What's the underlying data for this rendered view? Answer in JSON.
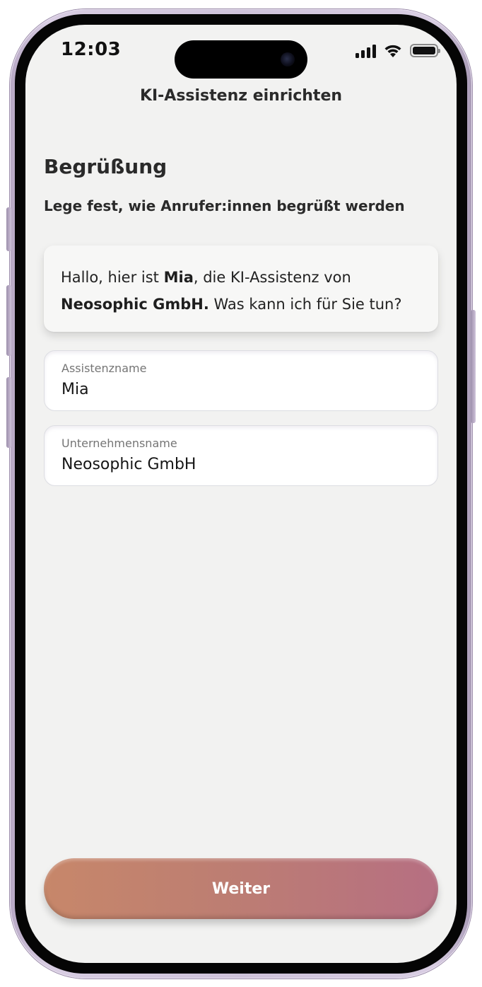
{
  "status_bar": {
    "time": "12:03",
    "signal_icon": "cellular-signal-icon",
    "wifi_icon": "wifi-icon",
    "battery_icon": "battery-icon",
    "battery_level": 1.0
  },
  "header": {
    "title": "KI-Assistenz einrichten"
  },
  "section": {
    "title": "Begrüßung",
    "subtitle": "Lege fest, wie Anrufer:innen begrüßt werden"
  },
  "greeting_preview": {
    "part1": "Hallo, hier ist ",
    "assistant_name": "Mia",
    "part2": ", die KI-Assistenz von ",
    "company_name": "Neosophic GmbH.",
    "part3": " Was kann ich für Sie tun?"
  },
  "fields": {
    "assistant_name": {
      "label": "Assistenzname",
      "value": "Mia"
    },
    "company_name": {
      "label": "Unternehmensname",
      "value": "Neosophic GmbH"
    }
  },
  "actions": {
    "continue_label": "Weiter"
  },
  "colors": {
    "screen_background": "#f2f2f1",
    "button_gradient_start": "#c7876a",
    "button_gradient_end": "#b66f82",
    "device_frame": "#cfc3da"
  }
}
